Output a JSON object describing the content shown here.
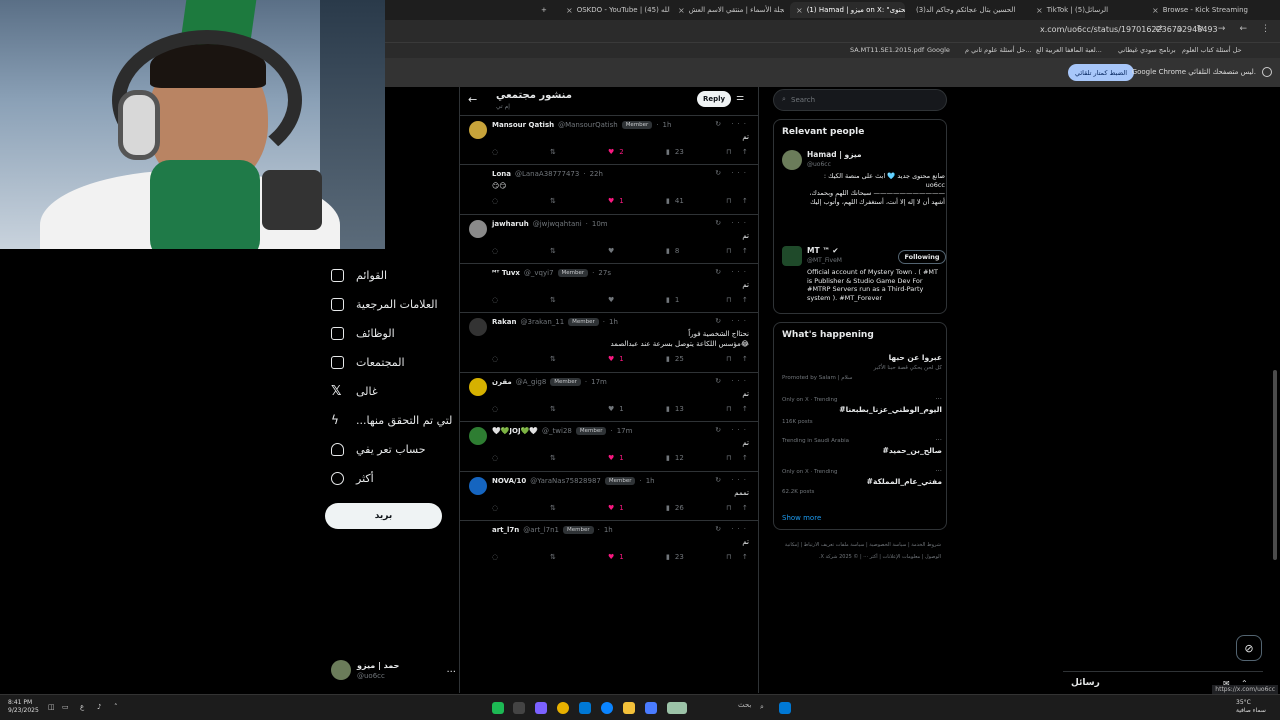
{
  "browser": {
    "tabs": [
      {
        "label": "OSKDO - YouTube | عبدالله (45)",
        "active": false
      },
      {
        "label": "عجلة الأسماء | منتقي الاسم العش",
        "active": false
      },
      {
        "label": "(1) Hamad | ميزو on X: \"محتوى",
        "active": true
      },
      {
        "label": "(3)الحسين بتال عجائكم وجاكم الد",
        "active": false
      },
      {
        "label": "TikTok | الرسائل(5)",
        "active": false
      },
      {
        "label": "Browse - Kick Streaming",
        "active": false
      }
    ],
    "url": "x.com/uo6cc/status/1970162236732948493",
    "bookmarks": [
      "SA.MT11.SE1.2015.pdf",
      "Google",
      "حل أسئلة علوم ثاني م...",
      "لعبة الماقفا العربية الع...",
      "برنامج سودي غيطاني",
      "حل أسئلة كتاب العلوم"
    ],
    "infobar": {
      "text": "Google Chrome ليس متصفحك التلقائي.",
      "button": "الضبط كمتار تلقائي"
    }
  },
  "left_nav": {
    "items": [
      {
        "label": "القوائم",
        "icon": "list-icon"
      },
      {
        "label": "العلامات المرجعية",
        "icon": "bookmark-icon"
      },
      {
        "label": "الوظائف",
        "icon": "briefcase-icon"
      },
      {
        "label": "المجتمعات",
        "icon": "communities-icon"
      },
      {
        "label": "غالى",
        "icon": "x-logo-icon"
      },
      {
        "label": "...لتي تم التحقق منها",
        "icon": "verified-bolt-icon"
      },
      {
        "label": "حساب تعر يفي",
        "icon": "profile-icon"
      },
      {
        "label": "أكثر",
        "icon": "more-circle-icon"
      }
    ],
    "post_button": "بريد",
    "profile": {
      "name": "حمد | ميزو",
      "handle": "@uo6cc",
      "more": "..."
    }
  },
  "feed": {
    "title": "منشور مجتمعي",
    "subtitle": "إم تي",
    "reply_button": "Reply",
    "rows": [
      {
        "name": "Mansour Qatish",
        "handle": "@MansourQatish",
        "badge": "Member",
        "time": "1h",
        "text": "تم",
        "likes": "2",
        "liked": true,
        "views": "23",
        "replies": "",
        "retweets": "",
        "avatar_color": "#c7a33a"
      },
      {
        "name": "Lona",
        "handle": "@LanaA38777473",
        "badge": "",
        "time": "22h",
        "text": "😏😏",
        "text_ltr": true,
        "likes": "1",
        "liked": true,
        "views": "41",
        "avatar_color": "#000000"
      },
      {
        "name": "jawharuh",
        "handle": "@jwjwqahtani",
        "badge": "",
        "time": "10m",
        "text": "تم",
        "likes": "",
        "liked": false,
        "views": "8",
        "avatar_color": "#8a8a8a"
      },
      {
        "name": "ᴹᵀ Tuvx",
        "handle": "@_vqyi7",
        "badge": "Member",
        "time": "27s",
        "text": "تم",
        "likes": "",
        "liked": false,
        "views": "1",
        "avatar_color": "#000000"
      },
      {
        "name": "Rakan",
        "handle": "@3rakan_11",
        "badge": "Member",
        "time": "1h",
        "text": "نحتااج الشخصية فوراً\nمؤسس اللكاعة يتوصل بسرعة عند عبدالصمد😂",
        "likes": "1",
        "liked": true,
        "views": "25",
        "avatar_color": "#333333"
      },
      {
        "name": "مقرن",
        "handle": "@A_gig8",
        "badge": "Member",
        "time": "17m",
        "text": "تم",
        "likes": "1",
        "liked": false,
        "views": "13",
        "avatar_color": "#d6b100"
      },
      {
        "name": "🤍💚JOJ💚🤍",
        "handle": "@_twi28",
        "badge": "Member",
        "time": "17m",
        "text": "تم",
        "likes": "1",
        "liked": true,
        "views": "12",
        "avatar_color": "#2e7d32"
      },
      {
        "name": "NOVA/10",
        "handle": "@YaraNas75828987",
        "badge": "Member",
        "time": "1h",
        "text": "تممم",
        "likes": "1",
        "liked": true,
        "views": "26",
        "avatar_color": "#1565c0"
      },
      {
        "name": "art_l7n",
        "handle": "@art_l7n1",
        "badge": "Member",
        "time": "1h",
        "text": "تم",
        "likes": "1",
        "liked": true,
        "views": "23",
        "avatar_color": "#000000"
      }
    ]
  },
  "right": {
    "search_placeholder": "Search",
    "relevant_title": "Relevant people",
    "people": [
      {
        "name": "Hamad | ميزو",
        "handle": "@uo6cc",
        "bio": "صانع محتوى جديد 🩵 ابث على منصة الكيك : uo6cc\n——————————— سبحانك اللهم وبحمدك، أشهد أن لا إله إلا أنت، أستغفرك اللهم، وأتوب إليك"
      },
      {
        "name": "MT ™ ✔",
        "handle": "@MT_FiveM",
        "bio": "Official account of Mystery Town . ( #MT is Publisher & Studio Game Dev For #MTRP Servers run as a Third-Party system ). #MT_Forever",
        "follow": "Following"
      }
    ],
    "happening_title": "What's happening",
    "promo": {
      "title": "عبروا عن حبها",
      "sub": "كل لحن يحكي قصة حبنا الأكبر",
      "by": "Promoted by Salam | سلام"
    },
    "trends": [
      {
        "meta": "Only on X · Trending",
        "title": "#اليوم_الوطني_عزنا_بطبعنا",
        "posts": "116K posts"
      },
      {
        "meta": "Trending in Saudi Arabia",
        "title": "#صالح_بن_حميد",
        "posts": ""
      },
      {
        "meta": "Only on X · Trending",
        "title": "#مفتي_عام_المملكة",
        "posts": "62.2K posts"
      }
    ],
    "show_more": "Show more",
    "footer": [
      "شروط الخدمة | سياسة الخصوصية | سياسة ملفات تعريف الارتباط | إمكانية الوصول | معلومات الإعلانات | أكثر ··· | © 2025 شركة X."
    ]
  },
  "messages": {
    "label": "رسائل"
  },
  "status_url": "https://x.com/uo6cc",
  "taskbar": {
    "time": "8:41 PM",
    "date": "9/23/2025",
    "search": "بحث",
    "weather": "35°C",
    "weather_sub": "سماء صافية"
  }
}
